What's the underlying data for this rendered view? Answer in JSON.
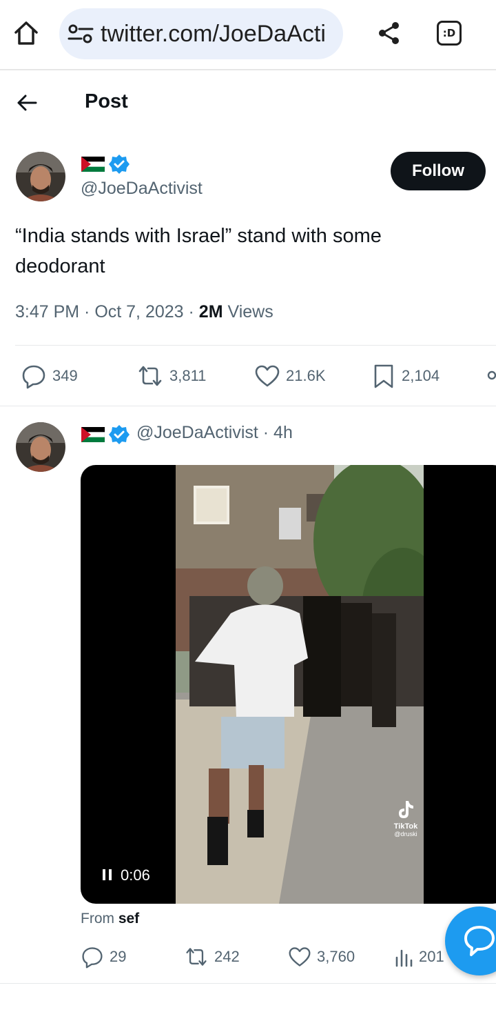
{
  "browser": {
    "url": "twitter.com/JoeDaActi",
    "tabs_label": ":D"
  },
  "header": {
    "title": "Post"
  },
  "tweet": {
    "handle": "@JoeDaActivist",
    "follow_label": "Follow",
    "text": "“India stands with Israel” stand with some deodorant",
    "time": "3:47 PM · Oct 7, 2023 · ",
    "views_count": "2M",
    "views_label": " Views",
    "stats": {
      "replies": "349",
      "reposts": "3,811",
      "likes": "21.6K",
      "bookmarks": "2,104"
    }
  },
  "reply": {
    "handle": "@JoeDaActivist",
    "age": "4h",
    "separator": " · ",
    "video_time": "0:06",
    "watermark": "TikTok",
    "watermark_sub": "@druski",
    "from_label": "From ",
    "from_user": "sef",
    "stats": {
      "replies": "29",
      "reposts": "242",
      "likes": "3,760",
      "views": "201"
    }
  },
  "colors": {
    "accent": "#1d9bf0",
    "text": "#0f1419",
    "secondary": "#536471",
    "url_bg": "#eaf0fb"
  },
  "icons": [
    "home-icon",
    "tune-icon",
    "share-icon",
    "tabs-icon",
    "back-arrow-icon",
    "verified-badge-icon",
    "flag-icon",
    "reply-icon",
    "repost-icon",
    "like-icon",
    "bookmark-icon",
    "views-icon",
    "pause-icon",
    "chat-icon"
  ]
}
